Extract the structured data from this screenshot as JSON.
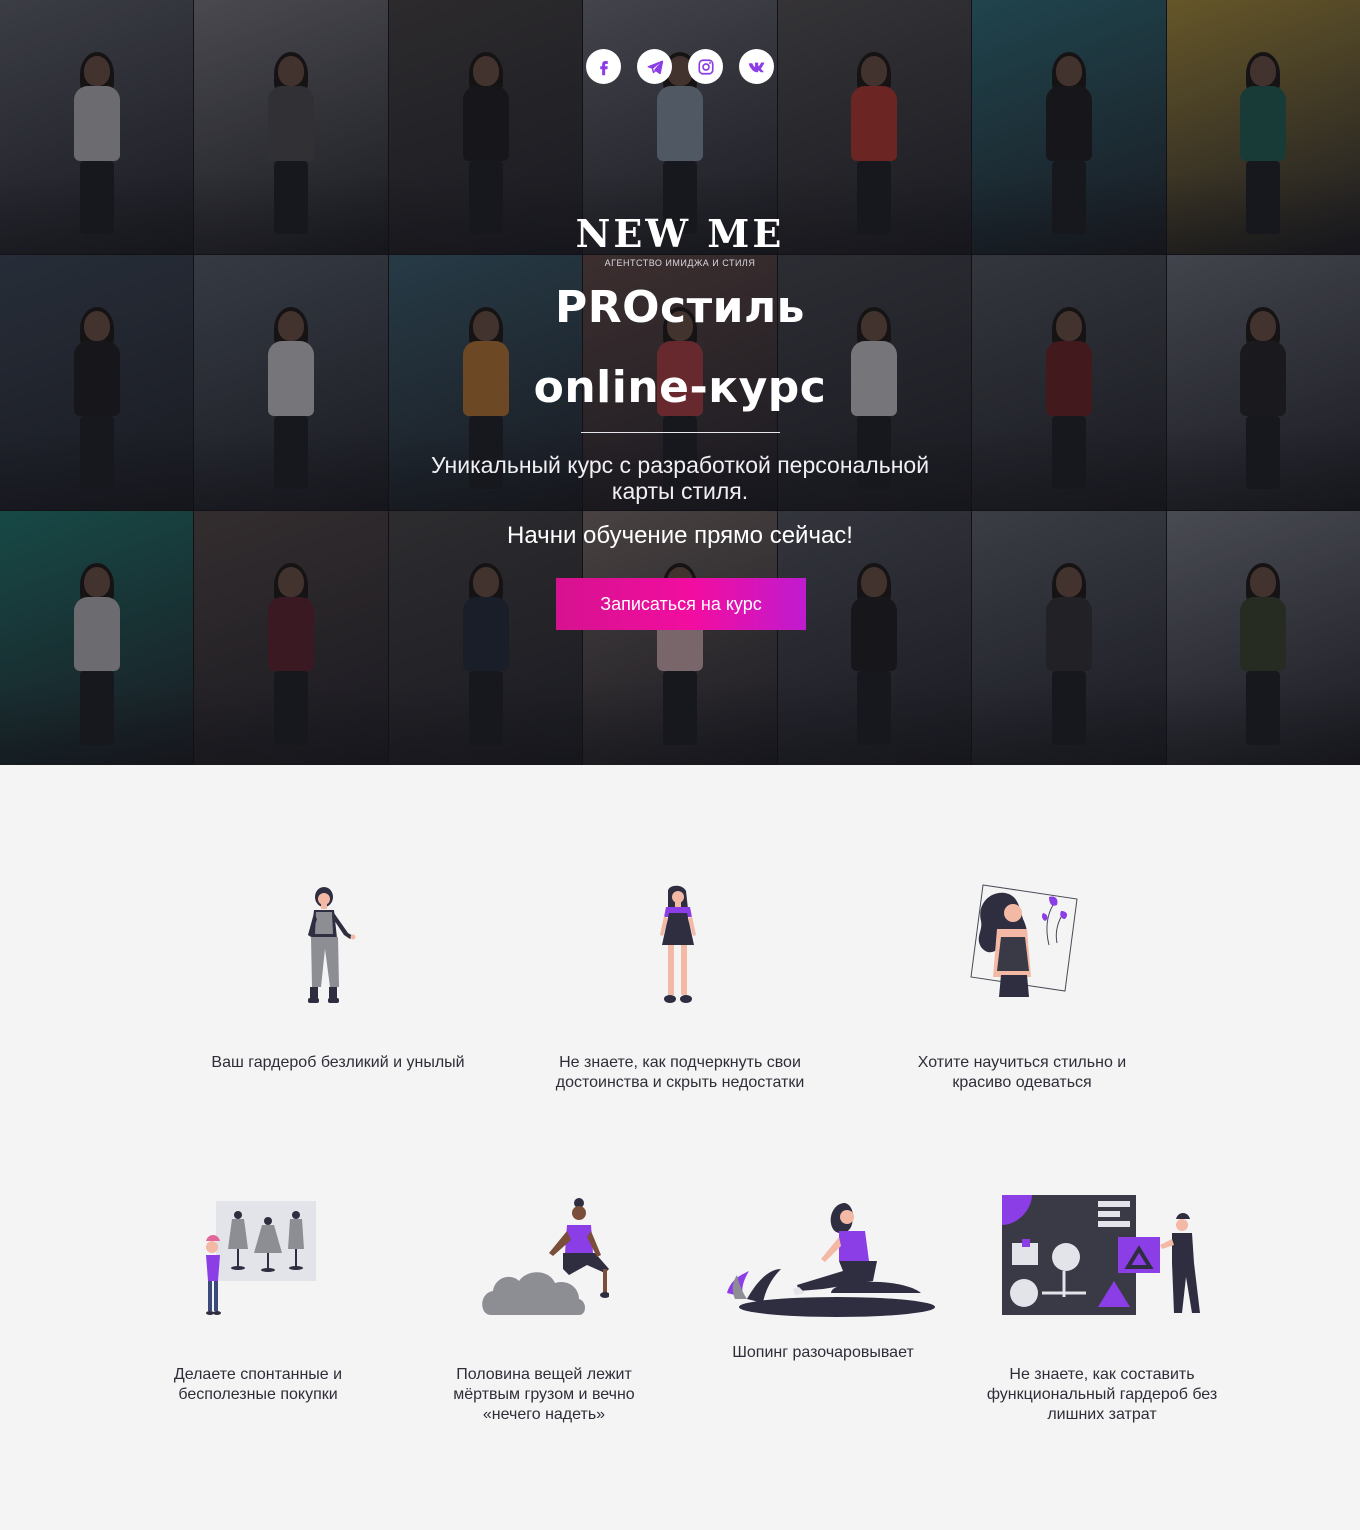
{
  "colors": {
    "accent_start": "#d6128f",
    "accent_end": "#c01bcf",
    "illustration_purple": "#8b3ee6",
    "illustration_dark": "#2f2e41",
    "page_bg": "#f4f4f5"
  },
  "social": [
    {
      "name": "facebook",
      "icon": "facebook-icon"
    },
    {
      "name": "telegram",
      "icon": "telegram-icon"
    },
    {
      "name": "instagram",
      "icon": "instagram-icon"
    },
    {
      "name": "vk",
      "icon": "vk-icon"
    }
  ],
  "hero": {
    "brand": "NEW ME",
    "brand_sub": "АГЕНТСТВО ИМИДЖА И СТИЛЯ",
    "title_line1": "PROстиль",
    "title_line2": "online-курс",
    "description": "Уникальный курс с разработкой персональной карты стиля.",
    "cta_text": "Начни обучение прямо сейчас!",
    "cta_button": "Записаться на курс"
  },
  "pains": [
    {
      "label": "Ваш гардероб безликий и унылый",
      "illustration": "woman-gray-jumpsuit-illustration"
    },
    {
      "label": "Не знаете, как подчеркнуть свои достоинства и скрыть недостатки",
      "illustration": "woman-black-dress-illustration"
    },
    {
      "label": "Хотите научиться стильно и красиво одеваться",
      "illustration": "woman-portrait-frame-illustration"
    },
    {
      "label": "Делаете спонтанные и бесполезные покупки",
      "illustration": "woman-mannequins-illustration"
    },
    {
      "label": "Половина вещей лежит мёртвым грузом и вечно «нечего надеть»",
      "illustration": "woman-on-cloud-illustration"
    },
    {
      "label": "Шопинг разочаровывает",
      "illustration": "woman-sitting-illustration"
    },
    {
      "label": "Не знаете, как составить функциональный гардероб без лишних затрат",
      "illustration": "woman-shapes-board-illustration"
    }
  ]
}
